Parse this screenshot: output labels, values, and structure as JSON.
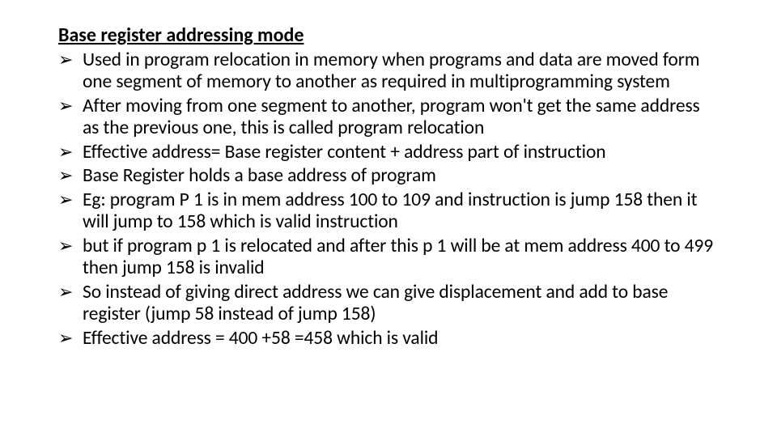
{
  "heading": "Base register addressing mode",
  "bullets": [
    "Used in program relocation in memory when programs and data are moved form one segment of memory to another as required in multiprogramming system",
    "After moving from one segment to another, program won't get the same address as the previous one, this is called program relocation",
    "Effective address= Base register content + address part of instruction",
    "Base Register holds a base address of program",
    "Eg:  program P 1 is in mem address 100 to 109 and instruction is jump 158 then it will jump to 158 which is valid instruction",
    " but if program p 1 is relocated and after this p 1 will be at mem address 400 to 499 then jump 158 is invalid",
    "So instead of giving direct address we can give displacement and add to base register (jump 58 instead of jump 158)",
    "Effective address = 400 +58 =458 which is valid"
  ]
}
